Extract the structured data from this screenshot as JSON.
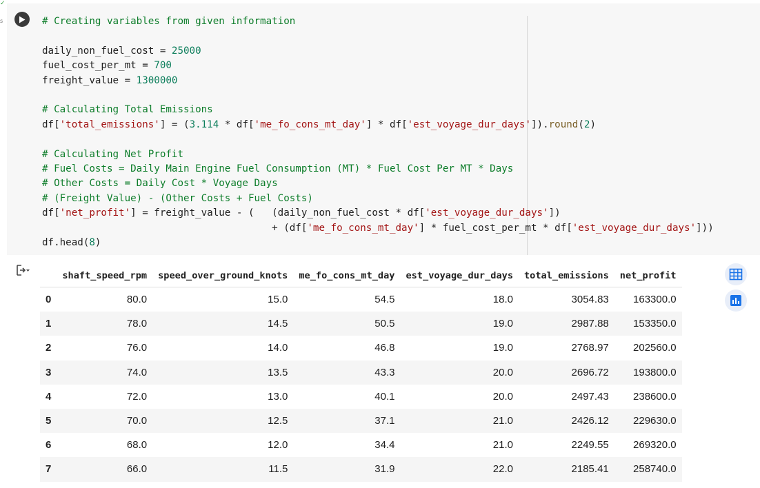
{
  "cell": {
    "exec_tick": "✓",
    "exec_count": "s",
    "code_lines": [
      [
        {
          "t": "# Creating variables from given information",
          "k": "c"
        }
      ],
      [],
      [
        {
          "t": "daily_non_fuel_cost = ",
          "k": ""
        },
        {
          "t": "25000",
          "k": "n"
        }
      ],
      [
        {
          "t": "fuel_cost_per_mt = ",
          "k": ""
        },
        {
          "t": "700",
          "k": "n"
        }
      ],
      [
        {
          "t": "freight_value = ",
          "k": ""
        },
        {
          "t": "1300000",
          "k": "n"
        }
      ],
      [],
      [
        {
          "t": "# Calculating Total Emissions",
          "k": "c"
        }
      ],
      [
        {
          "t": "df[",
          "k": ""
        },
        {
          "t": "'total_emissions'",
          "k": "s"
        },
        {
          "t": "] = (",
          "k": ""
        },
        {
          "t": "3.114",
          "k": "n"
        },
        {
          "t": " * df[",
          "k": ""
        },
        {
          "t": "'me_fo_cons_mt_day'",
          "k": "s"
        },
        {
          "t": "] * df[",
          "k": ""
        },
        {
          "t": "'est_voyage_dur_days'",
          "k": "s"
        },
        {
          "t": "]).",
          "k": ""
        },
        {
          "t": "round",
          "k": "f"
        },
        {
          "t": "(",
          "k": ""
        },
        {
          "t": "2",
          "k": "n"
        },
        {
          "t": ")",
          "k": ""
        }
      ],
      [],
      [
        {
          "t": "# Calculating Net Profit",
          "k": "c"
        }
      ],
      [
        {
          "t": "# Fuel Costs = Daily Main Engine Fuel Consumption (MT) * Fuel Cost Per MT * Days",
          "k": "c"
        }
      ],
      [
        {
          "t": "# Other Costs = Daily Cost * Voyage Days",
          "k": "c"
        }
      ],
      [
        {
          "t": "# (Freight Value) - (Other Costs + Fuel Costs)",
          "k": "c"
        }
      ],
      [
        {
          "t": "df[",
          "k": ""
        },
        {
          "t": "'net_profit'",
          "k": "s"
        },
        {
          "t": "] = freight_value - (   (daily_non_fuel_cost * df[",
          "k": ""
        },
        {
          "t": "'est_voyage_dur_days'",
          "k": "s"
        },
        {
          "t": "])",
          "k": ""
        }
      ],
      [
        {
          "t": "                                       + (df[",
          "k": ""
        },
        {
          "t": "'me_fo_cons_mt_day'",
          "k": "s"
        },
        {
          "t": "] * fuel_cost_per_mt * df[",
          "k": ""
        },
        {
          "t": "'est_voyage_dur_days'",
          "k": "s"
        },
        {
          "t": "]))",
          "k": ""
        }
      ],
      [
        {
          "t": "df.head(",
          "k": ""
        },
        {
          "t": "8",
          "k": "n"
        },
        {
          "t": ")",
          "k": ""
        }
      ]
    ]
  },
  "icons": {
    "run": "play-icon",
    "output_toggle": "output-toggle-icon",
    "table": "table-icon",
    "chart": "bar-chart-icon"
  },
  "colors": {
    "accent": "#1a73e8",
    "run_button": "#3a3a3a",
    "editor_bg": "#f7f7f7"
  },
  "dataframe": {
    "columns": [
      "",
      "shaft_speed_rpm",
      "speed_over_ground_knots",
      "me_fo_cons_mt_day",
      "est_voyage_dur_days",
      "total_emissions",
      "net_profit"
    ],
    "rows": [
      [
        "0",
        "80.0",
        "15.0",
        "54.5",
        "18.0",
        "3054.83",
        "163300.0"
      ],
      [
        "1",
        "78.0",
        "14.5",
        "50.5",
        "19.0",
        "2987.88",
        "153350.0"
      ],
      [
        "2",
        "76.0",
        "14.0",
        "46.8",
        "19.0",
        "2768.97",
        "202560.0"
      ],
      [
        "3",
        "74.0",
        "13.5",
        "43.3",
        "20.0",
        "2696.72",
        "193800.0"
      ],
      [
        "4",
        "72.0",
        "13.0",
        "40.1",
        "20.0",
        "2497.43",
        "238600.0"
      ],
      [
        "5",
        "70.0",
        "12.5",
        "37.1",
        "21.0",
        "2426.12",
        "229630.0"
      ],
      [
        "6",
        "68.0",
        "12.0",
        "34.4",
        "21.0",
        "2249.55",
        "269320.0"
      ],
      [
        "7",
        "66.0",
        "11.5",
        "31.9",
        "22.0",
        "2185.41",
        "258740.0"
      ]
    ]
  }
}
